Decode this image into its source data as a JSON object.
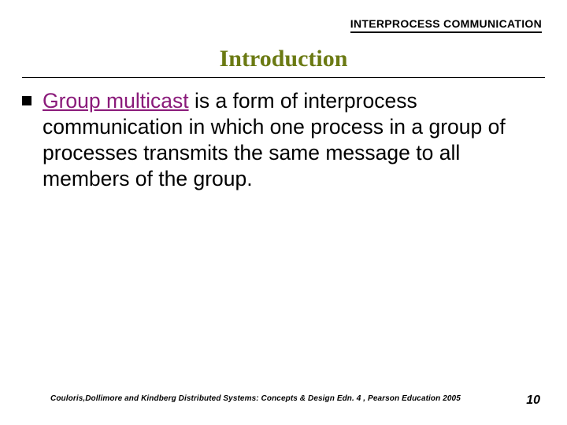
{
  "header": {
    "label": "INTERPROCESS COMMUNICATION"
  },
  "title": "Introduction",
  "body": {
    "highlight": "Group multicast",
    "rest": " is a form of interprocess communication in which one process in a group of processes transmits the same message to all members of the group."
  },
  "footer": {
    "citation": "Couloris,Dollimore and Kindberg  Distributed Systems: Concepts & Design  Edn. 4 ,  Pearson Education 2005",
    "page": "10"
  }
}
